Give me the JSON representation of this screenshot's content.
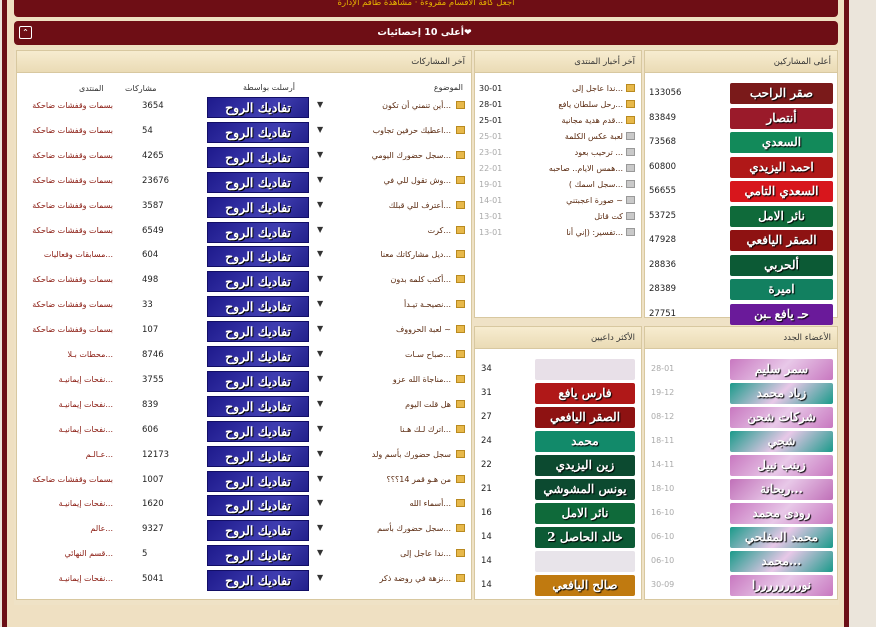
{
  "top_notice": "اجعل كافة الأقسام مقروءة · مشاهدة طاقم الإدارة",
  "stats_title": "أعلى 10 إحصائيات",
  "boxes": {
    "top_posters": "أعلى المشاركين",
    "latest_news": "آخر أخبار المنتدى",
    "latest_posts": "آخر المشاركات",
    "new_members": "الأعضاء الجدد",
    "top_inviters": "الأكثر داعيين"
  },
  "headers": {
    "topic": "الموضوع",
    "sent_by": "أرسلت بواسطة",
    "posts": "مشاركات",
    "forum": "المنتدى"
  },
  "top_posters": [
    {
      "name": "صقر الراحب",
      "count": "133056",
      "color": "#7a1a1a"
    },
    {
      "name": "أنتصار",
      "count": "83849",
      "color": "#9a1a2a"
    },
    {
      "name": "السعدي",
      "count": "73568",
      "color": "#128a5a"
    },
    {
      "name": "احمد اليزيدي",
      "count": "60800",
      "color": "#b01818"
    },
    {
      "name": "السعدي التامي",
      "count": "56655",
      "color": "#d8161c"
    },
    {
      "name": "نائر الامل",
      "count": "53725",
      "color": "#0f6a3a"
    },
    {
      "name": "الصقر اليافعي",
      "count": "47928",
      "color": "#8e1212"
    },
    {
      "name": "ألحربي",
      "count": "28836",
      "color": "#0c5a35"
    },
    {
      "name": "اميرة",
      "count": "28389",
      "color": "#128060"
    },
    {
      "name": "حـ يافع ـبن",
      "count": "27751",
      "color": "#6a1a9a"
    }
  ],
  "latest_news": [
    {
      "title": "ندا عاجل إلى...",
      "date": "30-01",
      "old": false
    },
    {
      "title": "رحل سلطان يافع...",
      "date": "28-01",
      "old": false
    },
    {
      "title": "قدم هدية مجانية...",
      "date": "25-01",
      "old": false
    },
    {
      "title": "لعبة عكس الكلمة",
      "date": "25-01",
      "old": true
    },
    {
      "title": "ترحيب بعود ...",
      "date": "23-01",
      "old": true
    },
    {
      "title": "همس الايام.. صاحبه...",
      "date": "22-01",
      "old": true
    },
    {
      "title": "( سجل اسمك...",
      "date": "19-01",
      "old": true
    },
    {
      "title": "صورة اعجبتني ~",
      "date": "14-01",
      "old": true
    },
    {
      "title": "كت قاتل",
      "date": "13-01",
      "old": true
    },
    {
      "title": "تفسير: (إني أنا...",
      "date": "13-01",
      "old": true
    }
  ],
  "new_members": [
    {
      "name": "سمر سليم",
      "date": "28-01",
      "color": "#c878c0"
    },
    {
      "name": "زياد محمد",
      "date": "19-12",
      "color": "#1a9a8a"
    },
    {
      "name": "شركات شحن",
      "date": "08-12",
      "color": "#c878c0"
    },
    {
      "name": "شجي",
      "date": "18-11",
      "color": "#1a9a8a"
    },
    {
      "name": "زينب نبيل",
      "date": "14-11",
      "color": "#c878c0"
    },
    {
      "name": "ريحانة...",
      "date": "18-10",
      "color": "#c070b8"
    },
    {
      "name": "رودى محمد",
      "date": "16-10",
      "color": "#c878c0"
    },
    {
      "name": "محمد المفلحي",
      "date": "06-10",
      "color": "#1a9a8a"
    },
    {
      "name": "محمد...",
      "date": "06-10",
      "color": "#1a9a8a"
    },
    {
      "name": "نوررررررررا",
      "date": "30-09",
      "color": "#c878c0"
    }
  ],
  "top_inviters": [
    {
      "name": "",
      "count": "34",
      "color": "#e8e0e8"
    },
    {
      "name": "فارس يافع",
      "count": "31",
      "color": "#b01818"
    },
    {
      "name": "الصقر اليافعي",
      "count": "27",
      "color": "#8e1212"
    },
    {
      "name": "محمد",
      "count": "24",
      "color": "#128a6a"
    },
    {
      "name": "زين اليزيدي",
      "count": "22",
      "color": "#0c4a30"
    },
    {
      "name": "يونس المشوشي",
      "count": "21",
      "color": "#0c4a30"
    },
    {
      "name": "نائر الامل",
      "count": "16",
      "color": "#0f6a3a"
    },
    {
      "name": "خالد الحاصل 2",
      "count": "14",
      "color": "#0c5a35"
    },
    {
      "name": "",
      "count": "14",
      "color": "#e8e4ea"
    },
    {
      "name": "صالح اليافعي",
      "count": "14",
      "color": "#c07a10"
    }
  ],
  "sender_name": "تفاديك الروح",
  "latest_posts": [
    {
      "topic": "أين تنمني أن تكون...",
      "posts": "3654",
      "forum": "بسمات وقفشات ضاحكة"
    },
    {
      "topic": "اعطيك حرفين تجاوب...",
      "posts": "54",
      "forum": "بسمات وقفشات ضاحكة"
    },
    {
      "topic": "سجل حضورك اليومي...",
      "posts": "4265",
      "forum": "بسمات وقفشات ضاحكة"
    },
    {
      "topic": "وش تقول للي في...",
      "posts": "23676",
      "forum": "بسمات وقفشات ضاحكة"
    },
    {
      "topic": "أعترف للي قبلك...",
      "posts": "3587",
      "forum": "بسمات وقفشات ضاحكة"
    },
    {
      "topic": "كرت...",
      "posts": "6549",
      "forum": "بسمات وقفشات ضاحكة"
    },
    {
      "topic": "ديل مشاركاتك معنا...",
      "posts": "604",
      "forum": "مسابقات وفعاليات..."
    },
    {
      "topic": "أكتب كلمه بدون...",
      "posts": "498",
      "forum": "بسمات وقفشات ضاحكة"
    },
    {
      "topic": "نصيحـة تيـدأ...",
      "posts": "33",
      "forum": "بسمات وقفشات ضاحكة"
    },
    {
      "topic": "لعبة الحرووف ~",
      "posts": "107",
      "forum": "بسمات وقفشات ضاحكة"
    },
    {
      "topic": "صباح سـات...",
      "posts": "8746",
      "forum": "محطات بـلا..."
    },
    {
      "topic": "مناجاة الله عزو...",
      "posts": "3755",
      "forum": "نفحات إيمانيـة..."
    },
    {
      "topic": "هل قلت اليوم",
      "posts": "839",
      "forum": "نفحات إيمانيـة..."
    },
    {
      "topic": "اترك لـك هـنا...",
      "posts": "606",
      "forum": "نفحات إيمانيـة..."
    },
    {
      "topic": "سجل حضورك بأسم ولد",
      "posts": "12173",
      "forum": "عـالـم..."
    },
    {
      "topic": "من هـو قمر 14؟؟؟",
      "posts": "1007",
      "forum": "بسمات وقفشات ضاحكة"
    },
    {
      "topic": "أسماء الله...",
      "posts": "1620",
      "forum": "نفحات إيمانيـة..."
    },
    {
      "topic": "سجل حضورك بأسم...",
      "posts": "9327",
      "forum": "عالم..."
    },
    {
      "topic": "ندا عاجل إلى...",
      "posts": "5",
      "forum": "قسم النهائي..."
    },
    {
      "topic": "نزهة في روضة ذكر...",
      "posts": "5041",
      "forum": "نفحات إيمانيـة..."
    }
  ]
}
